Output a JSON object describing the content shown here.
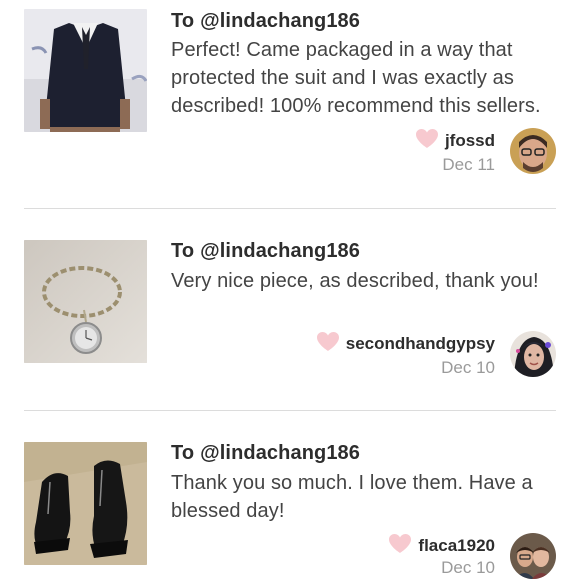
{
  "reviews": [
    {
      "to_prefix": "To",
      "to_user": "@lindachang186",
      "message": "Perfect! Came packaged in a way that protected the suit and I was exactly as described! 100% recommend this sellers.",
      "reviewer": "jfossd",
      "date": "Dec 11",
      "thumb_icon": "suit-photo",
      "avatar_icon": "reviewer-avatar"
    },
    {
      "to_prefix": "To",
      "to_user": "@lindachang186",
      "message": "Very nice piece, as described, thank you!",
      "reviewer": "secondhandgypsy",
      "date": "Dec 10",
      "thumb_icon": "bracelet-watch-photo",
      "avatar_icon": "reviewer-avatar"
    },
    {
      "to_prefix": "To",
      "to_user": "@lindachang186",
      "message": "Thank you so much. I love them. Have a blessed day!",
      "reviewer": "flaca1920",
      "date": "Dec 10",
      "thumb_icon": "ankle-boots-photo",
      "avatar_icon": "reviewer-avatar"
    }
  ],
  "colors": {
    "heart": "#f7c9cf",
    "text": "#444444",
    "muted": "#9a9a9a",
    "divider": "#dcdcdc"
  }
}
